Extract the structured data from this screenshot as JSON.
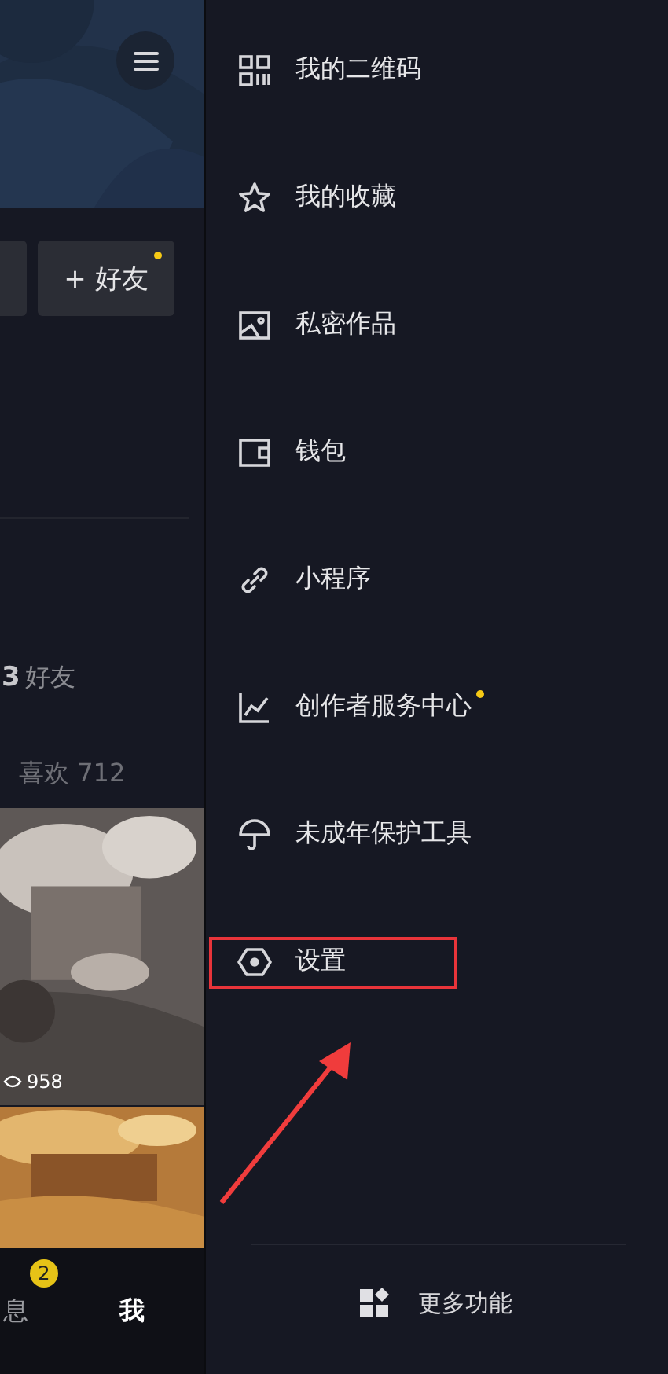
{
  "profile": {
    "add_friend_button": {
      "label": "+ 好友",
      "dot": true
    },
    "friends": {
      "count": "3",
      "label": "好友"
    },
    "likes_tab": "喜欢 712",
    "videos": [
      {
        "kind": "picture",
        "views": "958"
      },
      {
        "kind": "picture"
      }
    ]
  },
  "bottom_nav": [
    {
      "label": "息",
      "badge": "2",
      "selected": false
    },
    {
      "label": "我",
      "selected": true
    }
  ],
  "drawer": {
    "items": [
      {
        "label": "我的二维码",
        "dot": false,
        "annotated": false
      },
      {
        "label": "我的收藏",
        "dot": false,
        "annotated": false
      },
      {
        "label": "私密作品",
        "dot": false,
        "annotated": false
      },
      {
        "label": "钱包",
        "dot": false,
        "annotated": false
      },
      {
        "label": "小程序",
        "dot": false,
        "annotated": false
      },
      {
        "label": "创作者服务中心",
        "dot": true,
        "annotated": false
      },
      {
        "label": "未成年保护工具",
        "dot": false,
        "annotated": false
      },
      {
        "label": "设置",
        "dot": false,
        "annotated": true
      }
    ],
    "more": {
      "label": "更多功能"
    }
  }
}
